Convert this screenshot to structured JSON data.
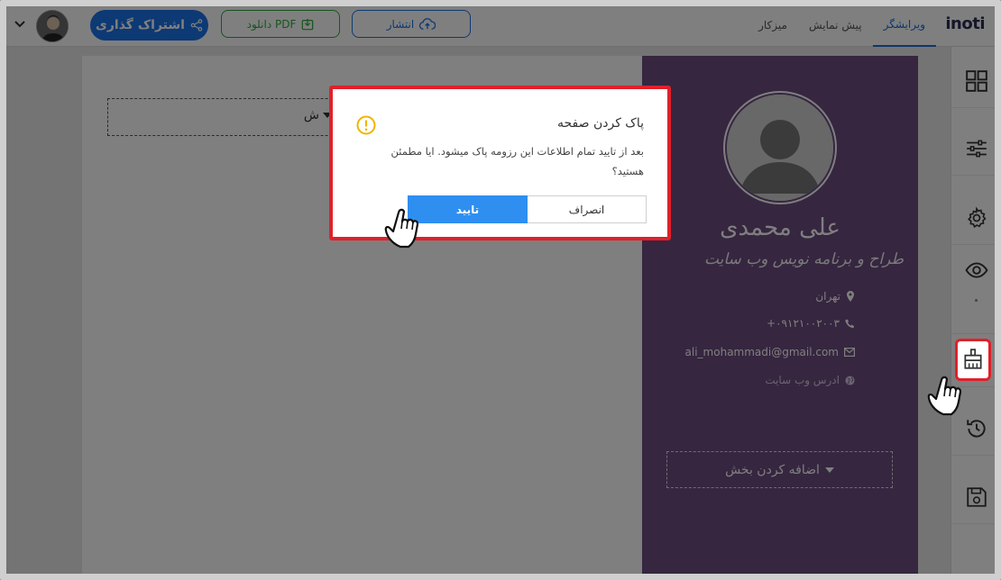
{
  "header": {
    "logo_text": "inoti",
    "tabs": [
      {
        "label": "ویرایشگر",
        "active": true
      },
      {
        "label": "پیش نمایش",
        "active": false
      },
      {
        "label": "میزکار",
        "active": false
      }
    ],
    "publish_label": "انتشار",
    "pdf_label": "دانلود PDF",
    "share_label": "اشتراک گذاری"
  },
  "sidebar": {
    "items": [
      {
        "icon": "grid-icon"
      },
      {
        "icon": "sliders-icon"
      },
      {
        "icon": "gear-icon"
      },
      {
        "icon": "eye-icon"
      },
      {
        "icon": "brush-icon",
        "highlighted": true
      },
      {
        "icon": "history-icon"
      },
      {
        "icon": "save-icon"
      }
    ]
  },
  "resume": {
    "name": "علی محمدی",
    "job_title": "طراح و برنامه نویس وب سایت",
    "city": "تهران",
    "phone": "+۰۹۱۲۱۰۰۲۰۰۳",
    "email": "ali_mohammadi@gmail.com",
    "website_placeholder": "ادرس وب سایت",
    "add_section_label": "اضافه کردن بخش",
    "left_section_label": "ش"
  },
  "dialog": {
    "title": "پاک کردن صفحه",
    "message": "بعد از تایید تمام اطلاعات این رزومه پاک میشود. ایا مطمئن هستید؟",
    "cancel_label": "انصراف",
    "confirm_label": "تایید"
  },
  "colors": {
    "accent": "#1a73e8",
    "pdf_green": "#2eaa3f",
    "resume_sidebar": "#6c4c81",
    "highlight_red": "#e0202a",
    "warning": "#f0b400"
  }
}
